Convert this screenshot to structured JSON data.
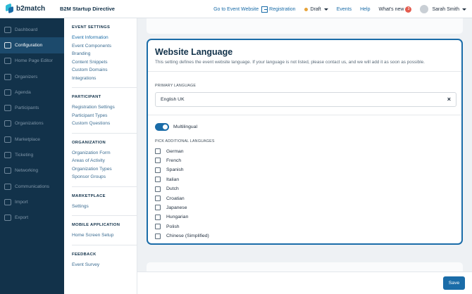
{
  "app": {
    "logo": "b2match",
    "event_title": "B2M Startup Directive"
  },
  "topbar": {
    "go_to_event": "Go to Event Website",
    "registration": "Registration",
    "status": "Draft",
    "status_color": "#e7a33a",
    "events": "Events",
    "help": "Help",
    "whats_new": "What's new",
    "whats_new_count": "3",
    "user": "Sarah Smith"
  },
  "nav": {
    "items": [
      {
        "label": "Dashboard",
        "icon": "dashboard-icon",
        "active": false
      },
      {
        "label": "Configuration",
        "icon": "gear-icon",
        "active": true
      },
      {
        "label": "Home Page Editor",
        "icon": "page-icon",
        "active": false
      },
      {
        "label": "Organizers",
        "icon": "organizers-icon",
        "active": false
      },
      {
        "label": "Agenda",
        "icon": "calendar-icon",
        "active": false
      },
      {
        "label": "Participants",
        "icon": "people-icon",
        "active": false
      },
      {
        "label": "Organizations",
        "icon": "building-icon",
        "active": false
      },
      {
        "label": "Marketplace",
        "icon": "store-icon",
        "active": false
      },
      {
        "label": "Ticketing",
        "icon": "ticket-icon",
        "active": false
      },
      {
        "label": "Networking",
        "icon": "network-icon",
        "active": false
      },
      {
        "label": "Communications",
        "icon": "message-icon",
        "active": false
      },
      {
        "label": "Import",
        "icon": "import-icon",
        "active": false
      },
      {
        "label": "Export",
        "icon": "export-icon",
        "active": false
      }
    ]
  },
  "submenu": {
    "sections": [
      {
        "heading": "EVENT SETTINGS",
        "items": [
          "Event Information",
          "Event Components",
          "Branding",
          "Content Snippets",
          "Custom Domains",
          "Integrations"
        ]
      },
      {
        "heading": "PARTICIPANT",
        "items": [
          "Registration Settings",
          "Participant Types",
          "Custom Questions"
        ]
      },
      {
        "heading": "ORGANIZATION",
        "items": [
          "Organization Form",
          "Areas of Activity",
          "Organization Types",
          "Sponsor Groups"
        ]
      },
      {
        "heading": "MARKETPLACE",
        "items": [
          "Settings"
        ]
      },
      {
        "heading": "MOBILE APPLICATION",
        "items": [
          "Home Screen Setup"
        ]
      },
      {
        "heading": "FEEDBACK",
        "items": [
          "Event Survey"
        ]
      }
    ]
  },
  "main": {
    "title": "Website Language",
    "description": "This setting defines the event website language. If your language is not listed, please contact us, and we will add it as soon as possible.",
    "primary_label": "PRIMARY LANGUAGE",
    "primary_value": "English UK",
    "multilingual_label": "Multilingual",
    "multilingual_on": true,
    "additional_label": "PICK ADDITIONAL LANGUAGES",
    "languages": [
      "German",
      "French",
      "Spanish",
      "Italian",
      "Dutch",
      "Croatian",
      "Japanese",
      "Hungarian",
      "Polish",
      "Chinese (Simplified)"
    ],
    "save_label": "Save",
    "accent_color": "#1a6ca8"
  }
}
